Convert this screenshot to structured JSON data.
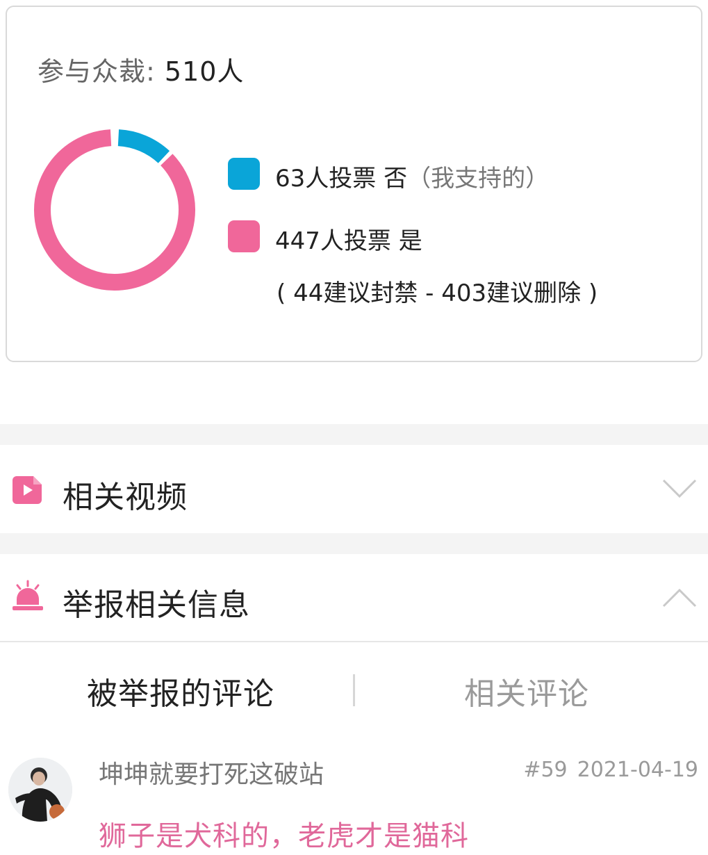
{
  "vote": {
    "title_label": "参与众裁: ",
    "title_count": "510人",
    "no_votes": 63,
    "yes_votes": 447,
    "no_label": "63人投票 否",
    "no_sub": "（我支持的）",
    "yes_label": "447人投票 是",
    "yes_detail": "( 44建议封禁 - 403建议删除 )",
    "colors": {
      "no": "#0aa5d8",
      "yes": "#f0679a"
    }
  },
  "sections": {
    "related_videos": {
      "label": "相关视频",
      "icon": "video-play-icon",
      "chevron": "chevron-down-icon"
    },
    "report_info": {
      "label": "举报相关信息",
      "icon": "alarm-siren-icon",
      "chevron": "chevron-up-icon"
    }
  },
  "tabs": {
    "reported_comment": "被举报的评论",
    "related_comments": "相关评论"
  },
  "comment": {
    "username": "坤坤就要打死这破站",
    "floor": "#59",
    "date": "2021-04-19",
    "text": "狮子是犬科的，老虎才是猫科",
    "text_color": "#e0689a"
  }
}
